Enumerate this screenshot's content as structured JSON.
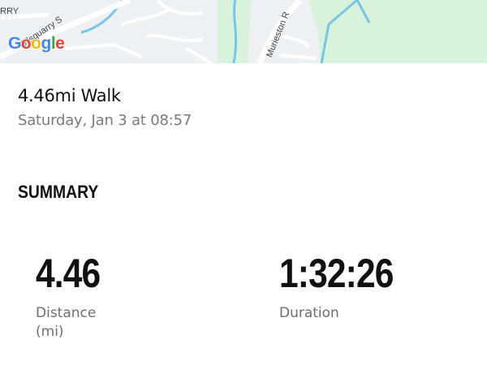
{
  "map": {
    "google_logo": [
      "G",
      "o",
      "o",
      "g",
      "l",
      "e"
    ],
    "street_labels": [
      "RRY",
      "Gilsquarry S",
      "Murieston R"
    ],
    "colors": {
      "road": "#ffffff",
      "park": "#d9f2dc",
      "water": "#74c7e6",
      "land": "#eef1f4"
    }
  },
  "activity": {
    "title": "4.46mi Walk",
    "date": "Saturday, Jan 3 at 08:57"
  },
  "summary": {
    "heading": "SUMMARY",
    "stats": [
      {
        "value": "4.46",
        "label": "Distance",
        "unit": "(mi)"
      },
      {
        "value": "1:32:26",
        "label": "Duration"
      }
    ]
  }
}
